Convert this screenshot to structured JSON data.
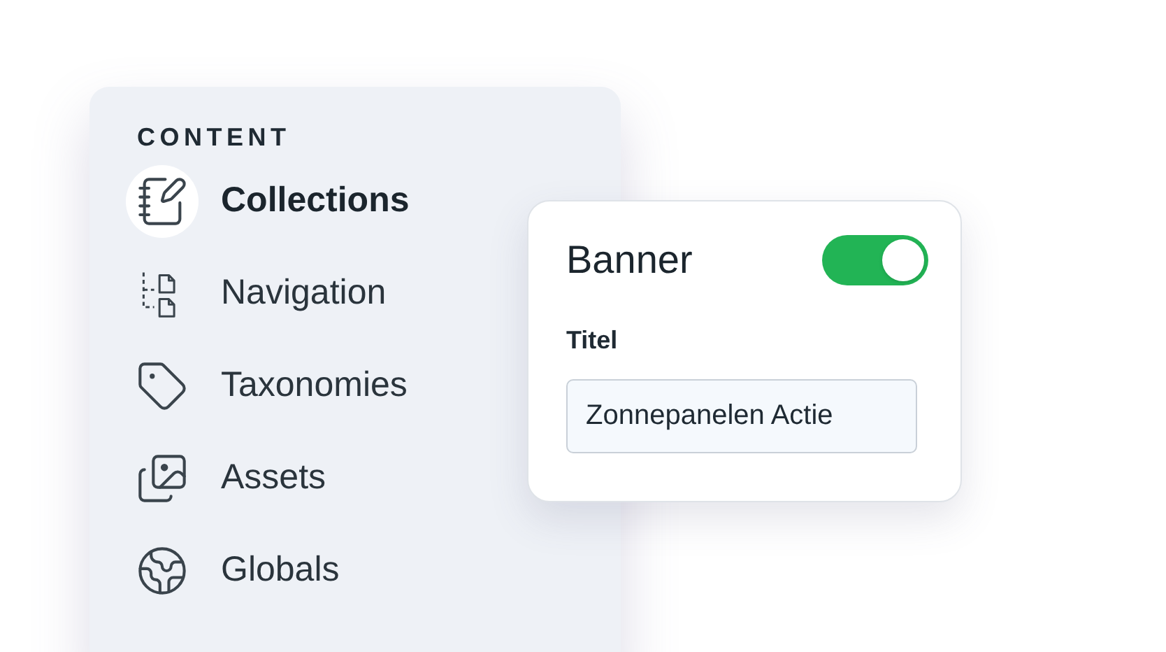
{
  "sidebar": {
    "heading": "CONTENT",
    "items": [
      {
        "label": "Collections",
        "selected": true
      },
      {
        "label": "Navigation",
        "selected": false
      },
      {
        "label": "Taxonomies",
        "selected": false
      },
      {
        "label": "Assets",
        "selected": false
      },
      {
        "label": "Globals",
        "selected": false
      }
    ]
  },
  "card": {
    "title": "Banner",
    "toggle": {
      "on": true
    },
    "field": {
      "label": "Titel",
      "value": "Zonnepanelen Actie"
    }
  }
}
